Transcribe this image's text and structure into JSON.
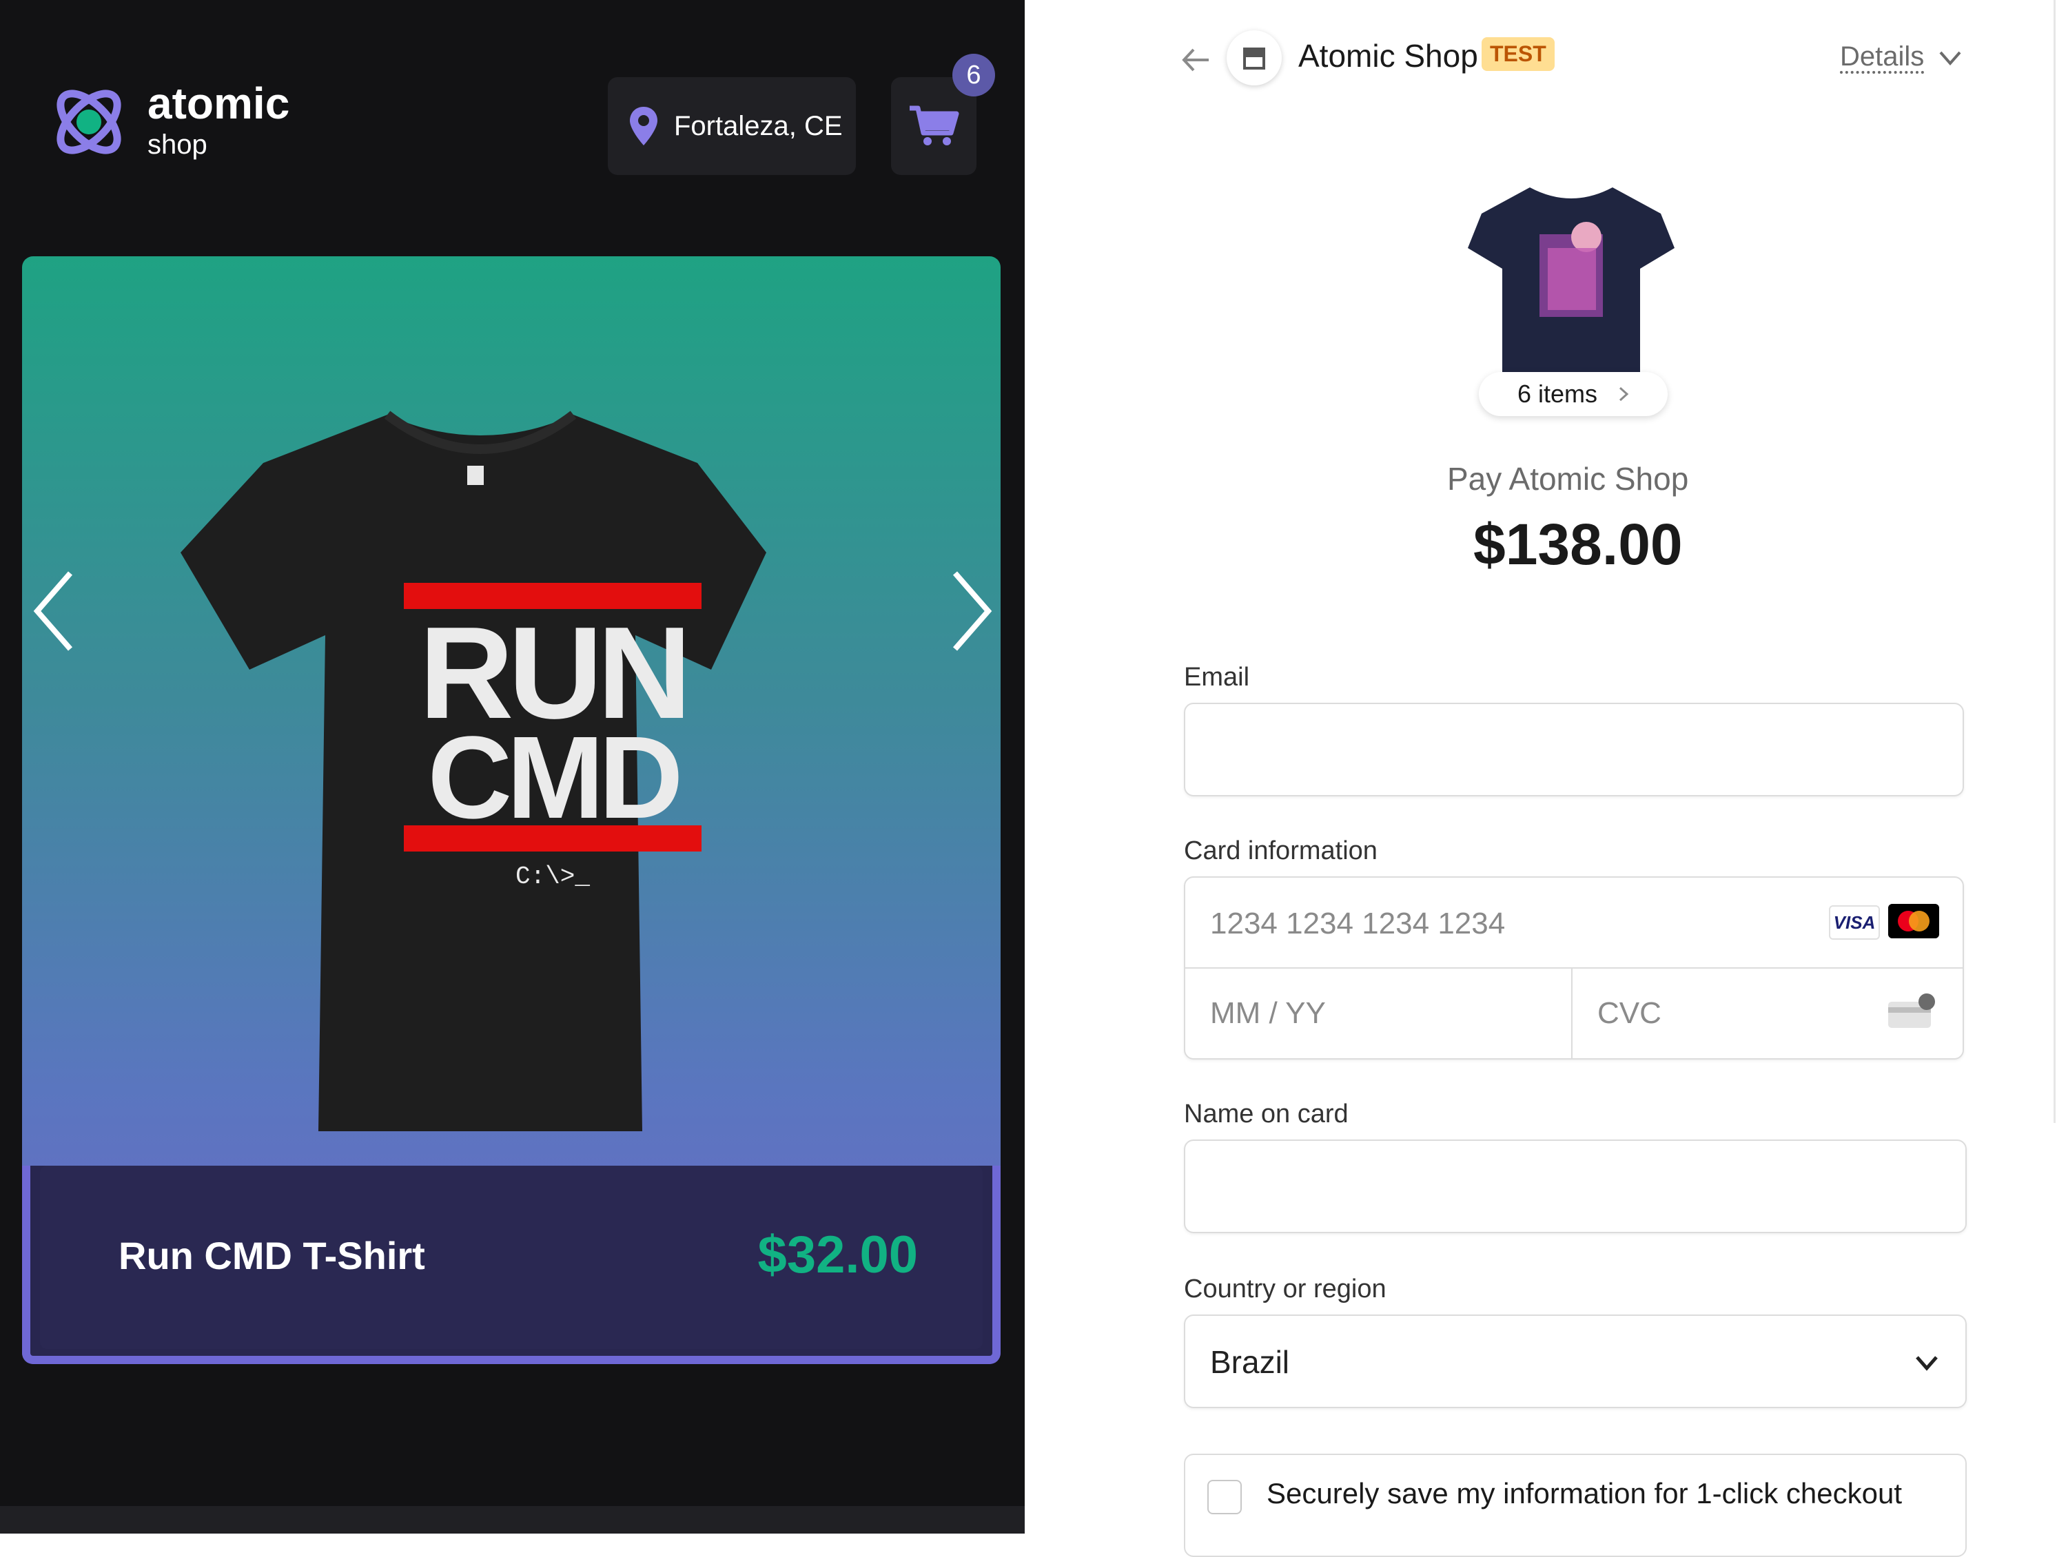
{
  "shop": {
    "brand_name": "atomic",
    "brand_sub": "shop",
    "location": "Fortaleza, CE",
    "cart_count": "6",
    "product": {
      "name": "Run CMD T-Shirt",
      "price": "$32.00",
      "shirt_text_line1": "RUN",
      "shirt_text_line2": "CMD",
      "shirt_prompt": "C:\\>_"
    },
    "colors": {
      "accent": "#6f68d6",
      "price": "#11b283",
      "bg": "#121214"
    }
  },
  "checkout": {
    "shop_name": "Atomic Shop",
    "test_badge": "TEST",
    "details_label": "Details",
    "items_label": "6 items",
    "pay_title": "Pay Atomic Shop",
    "amount": "$138.00",
    "email": {
      "label": "Email",
      "value": ""
    },
    "card": {
      "label": "Card information",
      "number_placeholder": "1234 1234 1234 1234",
      "expiry_placeholder": "MM / YY",
      "cvc_placeholder": "CVC",
      "visa_label": "VISA"
    },
    "name_on_card": {
      "label": "Name on card",
      "value": ""
    },
    "country": {
      "label": "Country or region",
      "value": "Brazil"
    },
    "save_info": "Securely save my information for 1-click checkout",
    "colors": {
      "test_bg": "#ffde92",
      "test_fg": "#bb5504"
    }
  }
}
